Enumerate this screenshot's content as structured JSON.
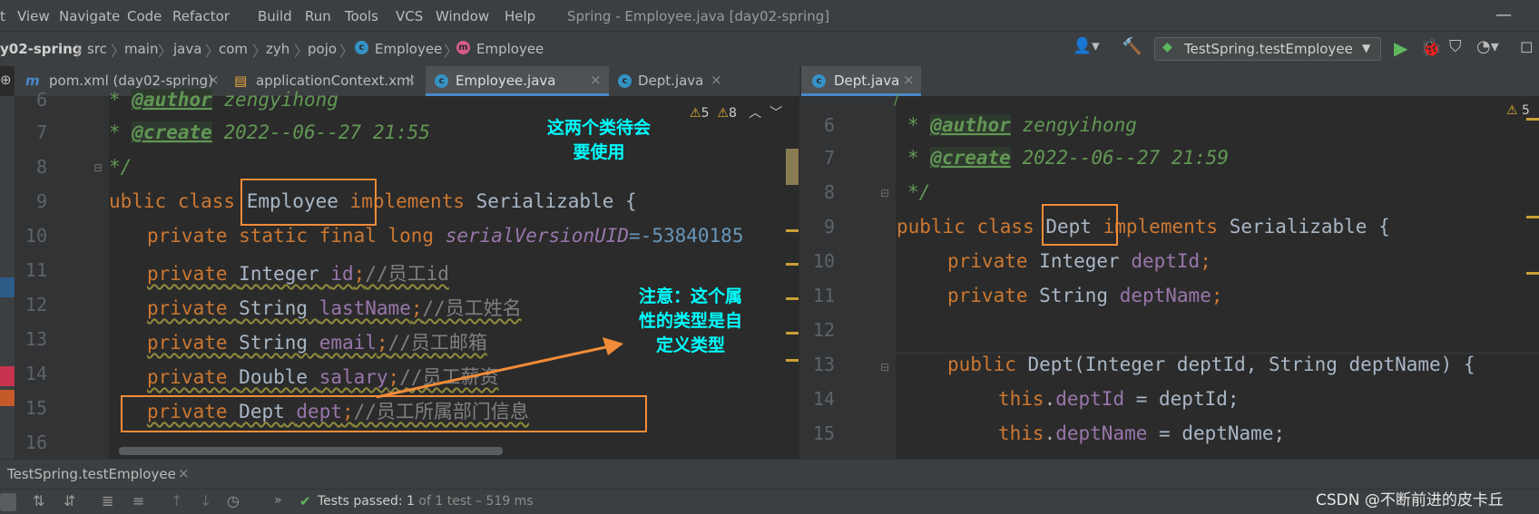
{
  "menu": {
    "items": [
      "t",
      "View",
      "Navigate",
      "Code",
      "Refactor",
      "Build",
      "Run",
      "Tools",
      "VCS",
      "Window",
      "Help"
    ],
    "window_title": "Spring - Employee.java [day02-spring]"
  },
  "breadcrumb": [
    "y02-spring",
    "src",
    "main",
    "java",
    "com",
    "zyh",
    "pojo",
    "Employee",
    "Employee"
  ],
  "run_config": "TestSpring.testEmployee",
  "tabs_left": [
    {
      "label": "pom.xml (day02-spring)",
      "icon": "m"
    },
    {
      "label": "applicationContext.xml",
      "icon": "xml"
    },
    {
      "label": "Employee.java",
      "icon": "c",
      "active": true
    },
    {
      "label": "Dept.java",
      "icon": "c"
    }
  ],
  "tabs_right": [
    {
      "label": "Dept.java",
      "icon": "c",
      "active": true
    }
  ],
  "left_editor": {
    "warnings": "5",
    "weak_warnings": "8",
    "line_numbers": [
      "6",
      "7",
      "8",
      "9",
      "10",
      "11",
      "12",
      "13",
      "14",
      "15",
      "16"
    ],
    "lines": {
      "l6_tag": "@author",
      "l6_text": " zengyihong",
      "l7_tag": "@create",
      "l7_text": " 2022--06--27 21:55",
      "l8": "*/",
      "l9_kw": "ublic class",
      "l9_name": "Employee",
      "l9_kw2": "implements",
      "l9_iface": "Serializable {",
      "l10_kw": "private static final long",
      "l10_fld": "serialVersionUID",
      "l10_num": "=-53840185",
      "l11_kw": "private",
      "l11_type": "Integer",
      "l11_fld": "id",
      "l11_cmt": "//员工id",
      "l12_kw": "private",
      "l12_type": "String",
      "l12_fld": "lastName",
      "l12_cmt": "//员工姓名",
      "l13_kw": "private",
      "l13_type": "String",
      "l13_fld": "email",
      "l13_cmt": "//员工邮箱",
      "l14_kw": "private",
      "l14_type": "Double",
      "l14_fld": "salary",
      "l14_cmt": "//员工薪资",
      "l15_kw": "private",
      "l15_type": "Dept",
      "l15_fld": "dept",
      "l15_cmt": "//员工所属部门信息"
    }
  },
  "right_editor": {
    "warnings": "5",
    "line_numbers": [
      "6",
      "7",
      "8",
      "9",
      "10",
      "11",
      "12",
      "13",
      "14",
      "15"
    ],
    "lines": {
      "l6_tag": "@author",
      "l6_text": " zengyihong",
      "l7_tag": "@create",
      "l7_text": " 2022--06--27 21:59",
      "l8": "*/",
      "l9_kw": "public class",
      "l9_name": "Dept",
      "l9_kw2": "implements",
      "l9_iface": "Serializable {",
      "l10_kw": "private",
      "l10_type": "Integer",
      "l10_fld": "deptId",
      "l11_kw": "private",
      "l11_type": "String",
      "l11_fld": "deptName",
      "l13_kw": "public",
      "l13_ctor": "Dept",
      "l13_params": "(Integer deptId, String deptName) {",
      "l14_kw": "this",
      "l14_fld": "deptId",
      "l14_rest": " = deptId;",
      "l15_kw": "this",
      "l15_fld": "deptName",
      "l15_rest": " = deptName;"
    }
  },
  "annotations": {
    "top": "这两个类待会要使用",
    "top_l1": "这两个类待会",
    "top_l2": "要使用",
    "note_l1": "注意：这个属",
    "note_l2": "性的类型是自",
    "note_l3": "定义类型"
  },
  "run_panel": {
    "tab_label": "TestSpring.testEmployee",
    "status_prefix": "Tests passed:",
    "status_count": "1",
    "status_detail": "of 1 test – 519 ms"
  },
  "watermark": "CSDN @不断前进的皮卡丘",
  "colors": {
    "accent_box": "#f28c38",
    "annotation": "#00ffff",
    "active_tab": "#4a88c7",
    "pass": "#5fb85f"
  }
}
